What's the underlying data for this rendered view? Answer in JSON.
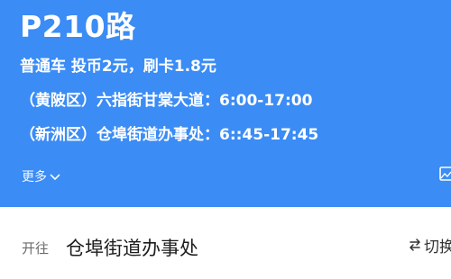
{
  "header": {
    "route_name": "P210路",
    "fare": "普通车 投币2元，刷卡1.8元",
    "schedules": [
      "（黄陂区）六指街甘棠大道：6:00-17:00",
      "（新洲区）仓埠街道办事处：6::45-17:45"
    ],
    "more_label": "更多",
    "more_icon": "chevron-down-icon",
    "corner_icon": "image-icon"
  },
  "direction": {
    "prefix": "开往",
    "destination": "仓埠街道办事处",
    "switch_label": "切换",
    "switch_icon": "swap-arrows-icon"
  },
  "colors": {
    "header_bg": "#3b8cf5",
    "page_bg": "#f2f3f5",
    "text_white": "#ffffff"
  }
}
